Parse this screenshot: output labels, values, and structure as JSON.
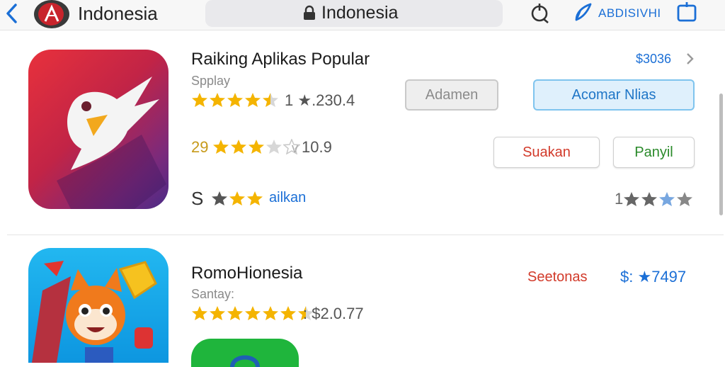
{
  "topbar": {
    "title": "Indonesia",
    "url": "Indonesia",
    "accent_text": "ABDISIVHI"
  },
  "icons": {
    "back": "chevron-left-icon",
    "logo": "logo-badge",
    "lock": "lock-icon",
    "reload": "reload-icon",
    "share": "share-icon",
    "tabs": "tabs-icon"
  },
  "colors": {
    "accent": "#1b6fd6",
    "star": "#f4b400",
    "star_empty": "#d7d7d7",
    "red_text": "#d23a2a",
    "green_text": "#2a8a2a"
  },
  "app1": {
    "name": "Raiking Aplikas Popular",
    "subtitle": "Spplay",
    "rating_text": "1 ★.230.4",
    "price": "$3036",
    "button_secondary": "Adamen",
    "button_primary": "Acomar Nlias",
    "row2_rating_prefix": "29",
    "row2_rating_text": "10.9",
    "button_red": "Suakan",
    "button_green": "Panyil",
    "row3_prefix": "S",
    "row3_link": "ailkan",
    "row3_right_count": "1"
  },
  "app2": {
    "name": "RomoHionesia",
    "subtitle": "Santay:",
    "rating_text": ": $2.0.77",
    "red_label": "Seetonas",
    "price_prefix": "$:",
    "price_value": "★7497"
  }
}
